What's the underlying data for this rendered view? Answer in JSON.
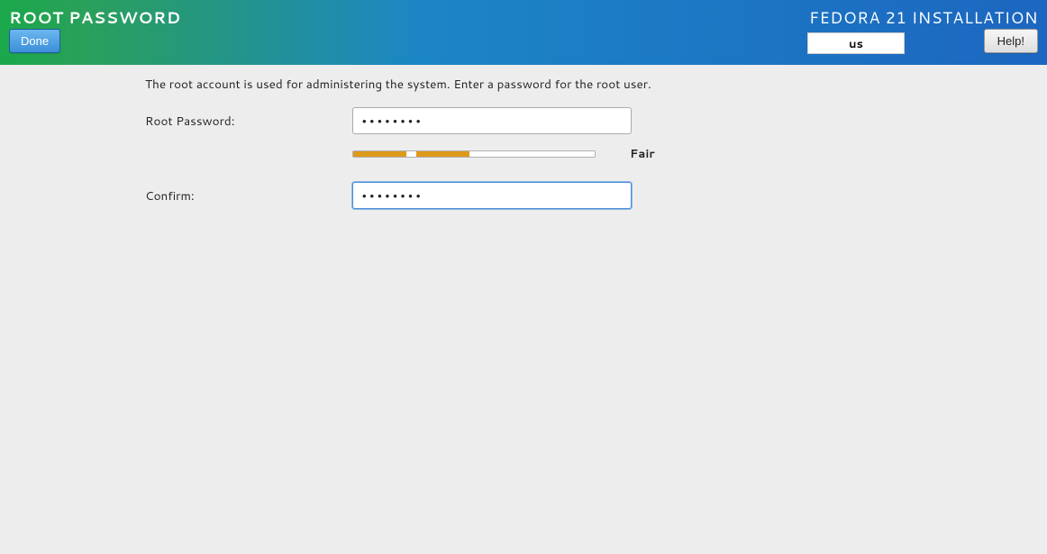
{
  "header": {
    "page_title": "ROOT PASSWORD",
    "product_title": "FEDORA 21 INSTALLATION",
    "done_label": "Done",
    "help_label": "Help!",
    "keyboard_layout": "us"
  },
  "form": {
    "intro": "The root account is used for administering the system.  Enter a password for the root user.",
    "root_password_label": "Root Password:",
    "confirm_label": "Confirm:",
    "password_mask": "●●●●●●●●",
    "confirm_mask": "●●●●●●●●",
    "strength_text": "Fair",
    "strength_percent": 48
  }
}
